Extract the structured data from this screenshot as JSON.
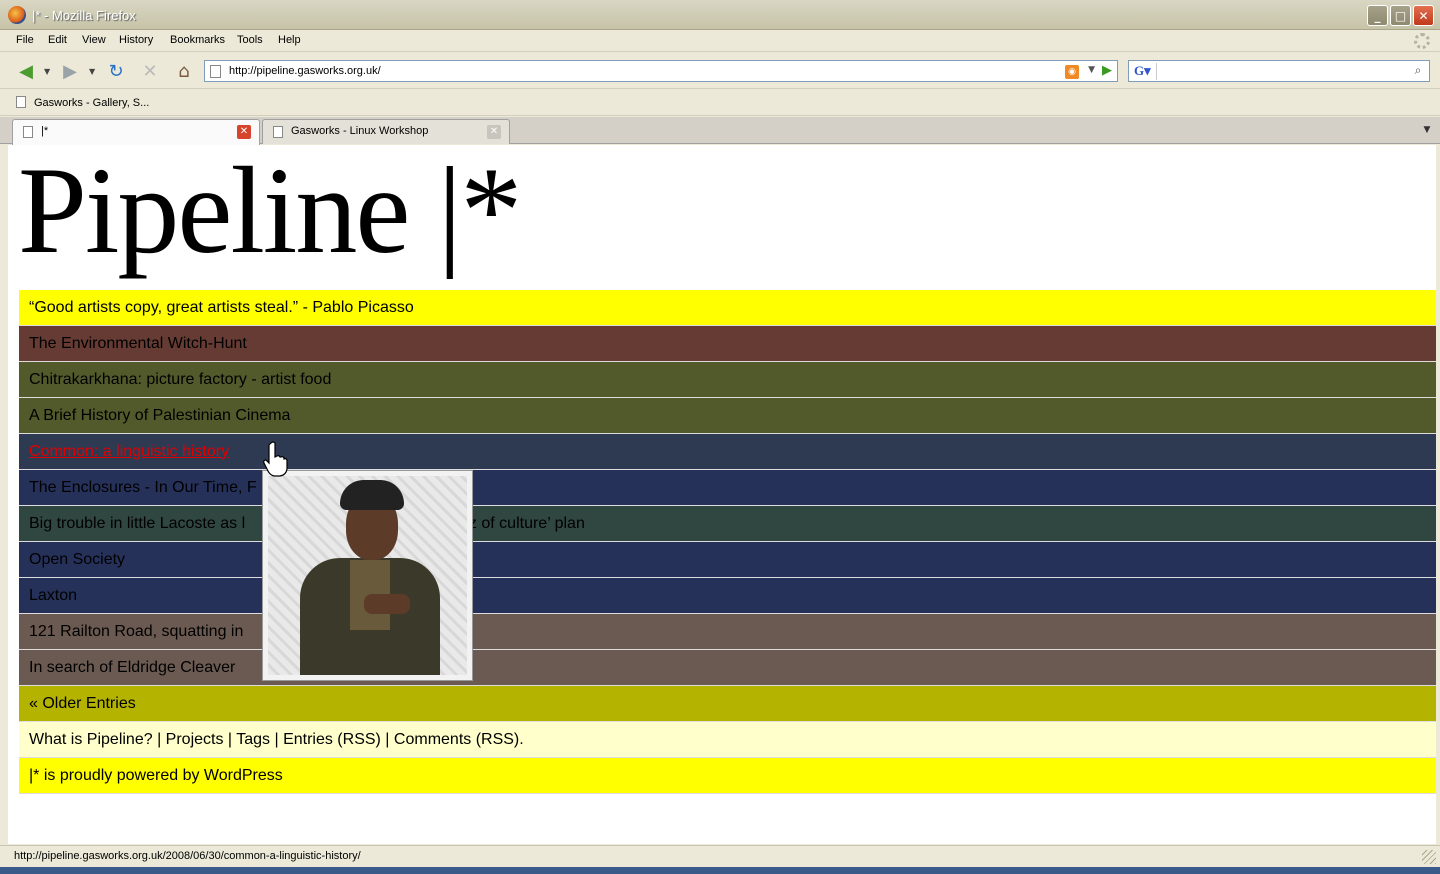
{
  "window": {
    "title": "|* - Mozilla Firefox",
    "controls": [
      "minimize",
      "maximize",
      "close"
    ]
  },
  "menubar": {
    "items": [
      "File",
      "Edit",
      "View",
      "History",
      "Bookmarks",
      "Tools",
      "Help"
    ]
  },
  "navbar": {
    "url": "http://pipeline.gasworks.org.uk/",
    "search_value": ""
  },
  "bookmarks": {
    "items": [
      "Gasworks - Gallery, S..."
    ]
  },
  "tabs": [
    {
      "label": "|*",
      "active": true
    },
    {
      "label": "Gasworks - Linux Workshop",
      "active": false
    }
  ],
  "page": {
    "logo": "Pipeline |*",
    "rows": [
      {
        "text": "“Good artists copy, great artists steal.” - Pablo Picasso",
        "color": "#ffff00"
      },
      {
        "text": "The Environmental Witch-Hunt",
        "color": "#663b33"
      },
      {
        "text": "Chitrakarkhana: picture factory - artist food",
        "color": "#525a2b"
      },
      {
        "text": "A Brief History of Palestinian Cinema",
        "color": "#525a2b"
      },
      {
        "text": "Common: a linguistic history",
        "color": "#2e3a52",
        "hovered": true
      },
      {
        "text": "The Enclosures - In Our Time, F",
        "color": "#26315a"
      },
      {
        "text": "Big trouble in little Lacoste as l",
        "tail": "t Tropez of culture’ plan",
        "color": "#304640"
      },
      {
        "text": "Open Society",
        "color": "#26315a"
      },
      {
        "text": "Laxton",
        "color": "#26315a"
      },
      {
        "text": "121 Railton Road, squatting in",
        "tail": "60s & 80s",
        "color": "#6b5a52"
      },
      {
        "text": "In search of Eldridge Cleaver",
        "color": "#6b5a52"
      },
      {
        "text": "« Older Entries",
        "color": "#b3b300"
      },
      {
        "text": "What is Pipeline? | Projects | Tags | Entries (RSS) | Comments (RSS).",
        "color": "#ffffcc"
      },
      {
        "text": "|* is proudly powered by WordPress",
        "color": "#ffff00"
      }
    ]
  },
  "status": {
    "text": "http://pipeline.gasworks.org.uk/2008/06/30/common-a-linguistic-history/"
  }
}
